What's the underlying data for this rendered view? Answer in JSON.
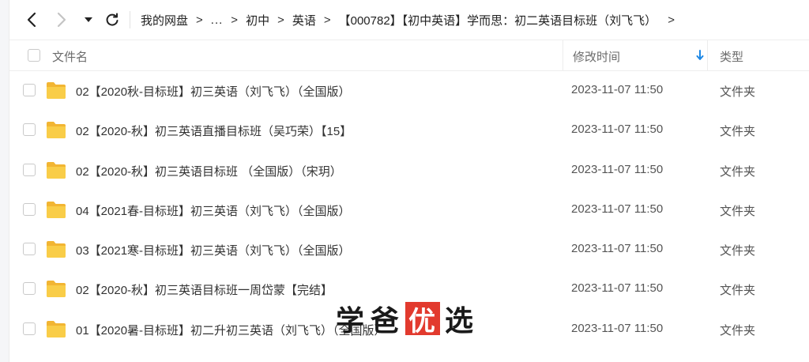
{
  "breadcrumb": {
    "items": [
      "我的网盘",
      "...",
      "初中",
      "英语",
      "【000782】【初中英语】学而思：初二英语目标班（刘飞飞）"
    ],
    "separator": ">"
  },
  "header": {
    "name_label": "文件名",
    "time_label": "修改时间",
    "type_label": "类型"
  },
  "files": [
    {
      "name": "02【2020秋-目标班】初三英语（刘飞飞）（全国版）",
      "time": "2023-11-07 11:50",
      "type": "文件夹"
    },
    {
      "name": "02【2020-秋】初三英语直播目标班（吴巧荣）【15】",
      "time": "2023-11-07 11:50",
      "type": "文件夹"
    },
    {
      "name": "02【2020-秋】初三英语目标班 （全国版）（宋玥）",
      "time": "2023-11-07 11:50",
      "type": "文件夹"
    },
    {
      "name": "04【2021春-目标班】初三英语（刘飞飞）（全国版）",
      "time": "2023-11-07 11:50",
      "type": "文件夹"
    },
    {
      "name": "03【2021寒-目标班】初三英语（刘飞飞）（全国版）",
      "time": "2023-11-07 11:50",
      "type": "文件夹"
    },
    {
      "name": "02【2020-秋】初三英语目标班一周岱蒙【完结】",
      "time": "2023-11-07 11:50",
      "type": "文件夹"
    },
    {
      "name": "01【2020暑-目标班】初二升初三英语（刘飞飞）（全国版）",
      "time": "2023-11-07 11:50",
      "type": "文件夹"
    }
  ],
  "watermark": {
    "chars": [
      "学",
      "爸",
      "优",
      "选"
    ]
  },
  "colors": {
    "folder": "#f5c242",
    "sort_arrow": "#1e88e5",
    "watermark_box": "#e23a2e"
  },
  "icons": {
    "back": "chevron-left-icon",
    "forward": "chevron-right-icon",
    "dropdown": "caret-down-icon",
    "refresh": "refresh-icon",
    "folder": "folder-icon",
    "sort": "sort-down-icon"
  }
}
